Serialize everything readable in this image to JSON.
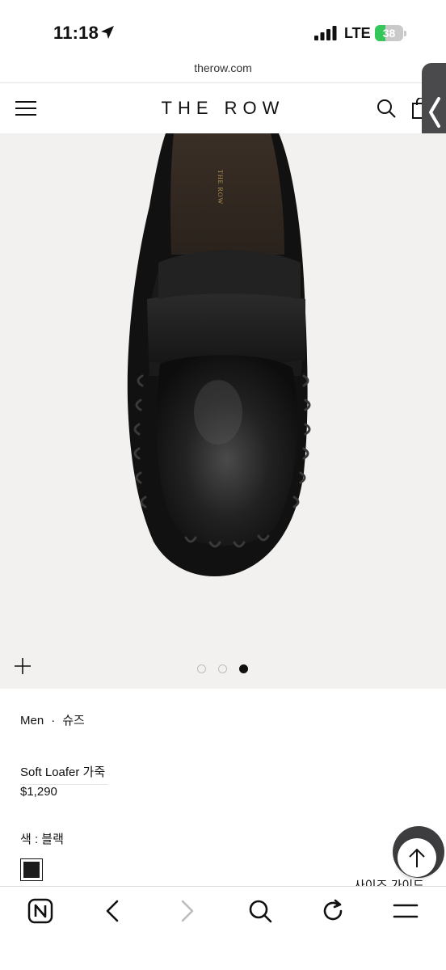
{
  "status_bar": {
    "time": "11:18",
    "network": "LTE",
    "battery": "38",
    "battery_level": 0.38,
    "battery_color": "#34c759"
  },
  "browser": {
    "url": "therow.com"
  },
  "header": {
    "brand": "THE ROW",
    "icons": [
      "menu-icon",
      "search-icon",
      "shopping-bag-icon"
    ]
  },
  "gallery": {
    "image": "black leather loafer, top view",
    "dot_count": 3,
    "active_index": 2
  },
  "product": {
    "category": "Men",
    "subcategory": "슈즈",
    "name": "Soft Loafer 가죽",
    "price": "$1,290",
    "color_label": "색 : 블랙",
    "swatch_color": "#1c1c1c",
    "size_guide": "사이즈 가이드"
  },
  "toolbar": {
    "icons": [
      "naver-home-icon",
      "back-icon",
      "forward-icon",
      "search-icon",
      "reload-icon",
      "menu-icon"
    ]
  }
}
